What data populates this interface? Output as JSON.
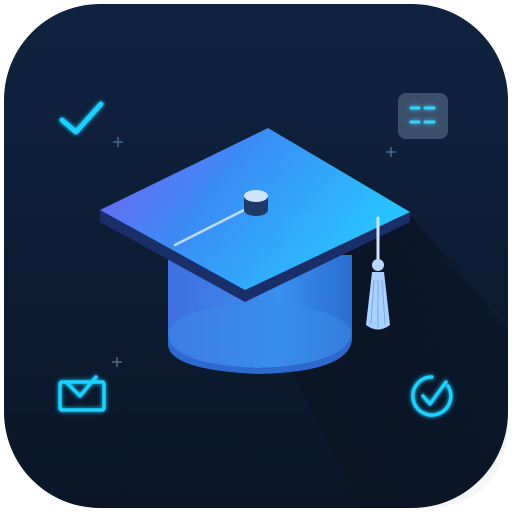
{
  "app_icon": {
    "title": "",
    "colors": {
      "background_top": "#0d2038",
      "background_bottom": "#0a1628",
      "cap_top_left": "#7b5cf0",
      "cap_top_right": "#2fb8ff",
      "cap_base": "#3a8ff0",
      "cap_edge": "#1a2f6a",
      "tassel": "#a9d0ff",
      "accent_glow": "#1fd0ff",
      "card_fill": "#3b4f6a"
    },
    "icons": [
      "checkmark-icon",
      "menu-card-icon",
      "graduation-cap-icon",
      "inbox-tray-icon",
      "clock-check-icon",
      "sparkle-icon"
    ]
  }
}
